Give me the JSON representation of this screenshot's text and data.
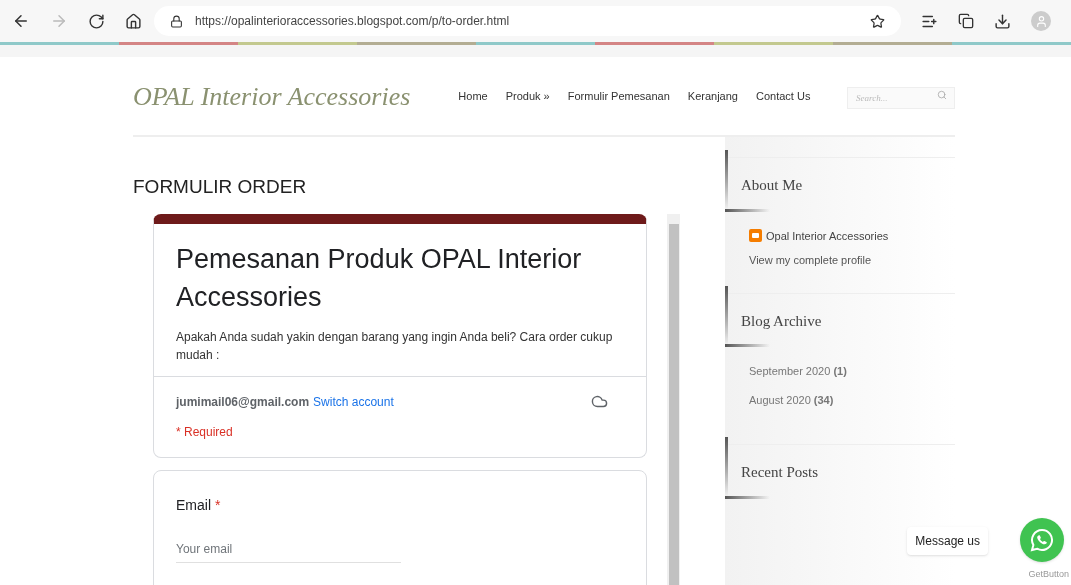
{
  "browser": {
    "url": "https://opalinterioraccessories.blogspot.com/p/to-order.html",
    "forward_disabled": true
  },
  "header": {
    "logo": "OPAL Interior Accessories",
    "nav": [
      "Home",
      "Produk »",
      "Formulir Pemesanan",
      "Keranjang",
      "Contact Us"
    ],
    "search": {
      "placeholder": "Search..."
    }
  },
  "page_title": "FORMULIR ORDER",
  "form": {
    "title": "Pemesanan Produk OPAL Interior Accessories",
    "description": "Apakah Anda sudah yakin dengan barang yang ingin Anda beli? Cara order cukup mudah :",
    "account": "jumimail06@gmail.com",
    "switch_link": "Switch account",
    "required_note": "* Required",
    "questions": [
      {
        "label": "Email",
        "required_mark": "*",
        "placeholder": "Your email"
      }
    ]
  },
  "sidebar": [
    {
      "title": "About Me",
      "kind": "profile",
      "name": "Opal Interior Accessories",
      "link": "View my complete profile"
    },
    {
      "title": "Blog Archive",
      "kind": "archive",
      "items": [
        "September 2020 **(1)**",
        "August 2020 **(34)**"
      ]
    },
    {
      "title": "Recent Posts",
      "kind": "posts"
    }
  ],
  "chat": {
    "bubble": "Message us",
    "credit": "GetButton"
  }
}
